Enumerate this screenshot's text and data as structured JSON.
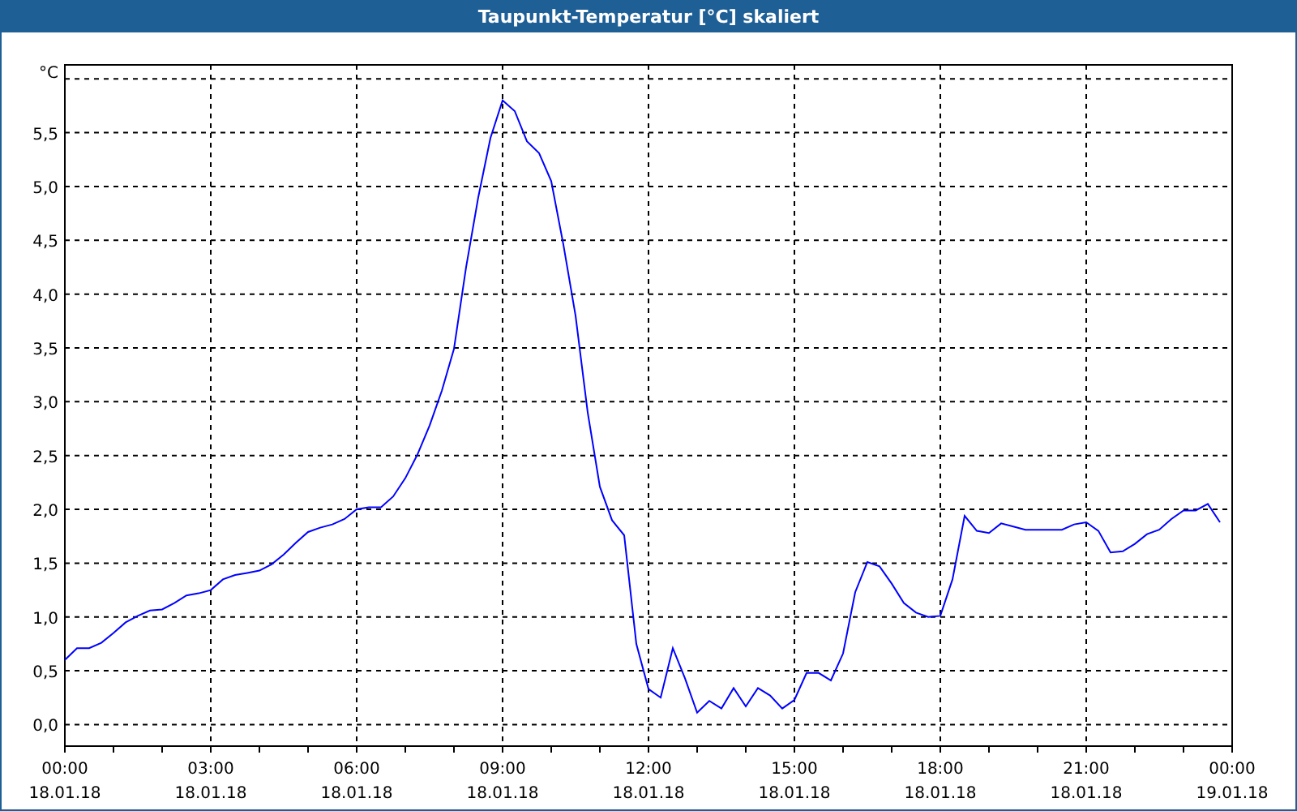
{
  "window": {
    "title": "Taupunkt-Temperatur [°C] skaliert"
  },
  "chart": {
    "chart_data": {
      "type": "line",
      "ylabel": "°C",
      "categories": [
        "00:00\n18.01.18",
        null,
        null,
        null,
        null,
        null,
        null,
        null,
        null,
        null,
        null,
        null,
        "03:00\n18.01.18",
        null,
        null,
        null,
        null,
        null,
        null,
        null,
        null,
        null,
        null,
        null,
        "06:00\n18.01.18",
        null,
        null,
        null,
        null,
        null,
        null,
        null,
        null,
        null,
        null,
        null,
        "09:00\n18.01.18",
        null,
        null,
        null,
        null,
        null,
        null,
        null,
        null,
        null,
        null,
        null,
        "12:00\n18.01.18",
        null,
        null,
        null,
        null,
        null,
        null,
        null,
        null,
        null,
        null,
        null,
        "15:00\n18.01.18",
        null,
        null,
        null,
        null,
        null,
        null,
        null,
        null,
        null,
        null,
        null,
        "18:00\n18.01.18",
        null,
        null,
        null,
        null,
        null,
        null,
        null,
        null,
        null,
        null,
        null,
        "21:00\n18.01.18",
        null,
        null,
        null,
        null,
        null,
        null,
        null,
        null,
        null,
        null,
        null,
        "00:00\n19.01.18"
      ],
      "series": [
        {
          "color": "#0000ff",
          "values": [
            0.6,
            0.71,
            0.71,
            0.76,
            0.85,
            0.95,
            1.01,
            1.06,
            1.07,
            1.13,
            1.2,
            1.22,
            1.25,
            1.35,
            1.39,
            1.41,
            1.43,
            1.49,
            1.58,
            1.69,
            1.79,
            1.83,
            1.86,
            1.91,
            2.0,
            2.02,
            2.02,
            2.12,
            2.29,
            2.51,
            2.78,
            3.1,
            3.49,
            4.25,
            4.9,
            5.45,
            5.8,
            5.7,
            5.42,
            5.31,
            5.05,
            4.46,
            3.8,
            2.9,
            2.21,
            1.9,
            1.76,
            0.75,
            0.33,
            0.25,
            0.71,
            0.43,
            0.11,
            0.22,
            0.15,
            0.34,
            0.17,
            0.34,
            0.27,
            0.15,
            0.23,
            0.48,
            0.48,
            0.41,
            0.66,
            1.23,
            1.51,
            1.47,
            1.31,
            1.13,
            1.04,
            1.0,
            1.01,
            1.35,
            1.94,
            1.8,
            1.78,
            1.87,
            1.84,
            1.81,
            1.81,
            1.81,
            1.81,
            1.86,
            1.88,
            1.8,
            1.6,
            1.61,
            1.68,
            1.77,
            1.81,
            1.91,
            1.99,
            1.99,
            2.05,
            1.88,
            null
          ]
        }
      ],
      "grid": true,
      "ylim": [
        -0.2,
        6.13
      ],
      "yticks": [
        {
          "value": 0,
          "label": "0,0"
        },
        {
          "value": 0.5,
          "label": "0,5"
        },
        {
          "value": 1,
          "label": "1,0"
        },
        {
          "value": 1.5,
          "label": "1,5"
        },
        {
          "value": 2,
          "label": "2,0"
        },
        {
          "value": 2.5,
          "label": "2,5"
        },
        {
          "value": 3,
          "label": "3,0"
        },
        {
          "value": 3.5,
          "label": "3,5"
        },
        {
          "value": 4,
          "label": "4,0"
        },
        {
          "value": 4.5,
          "label": "4,5"
        },
        {
          "value": 5,
          "label": "5,0"
        },
        {
          "value": 5.5,
          "label": "5,5"
        }
      ]
    }
  }
}
